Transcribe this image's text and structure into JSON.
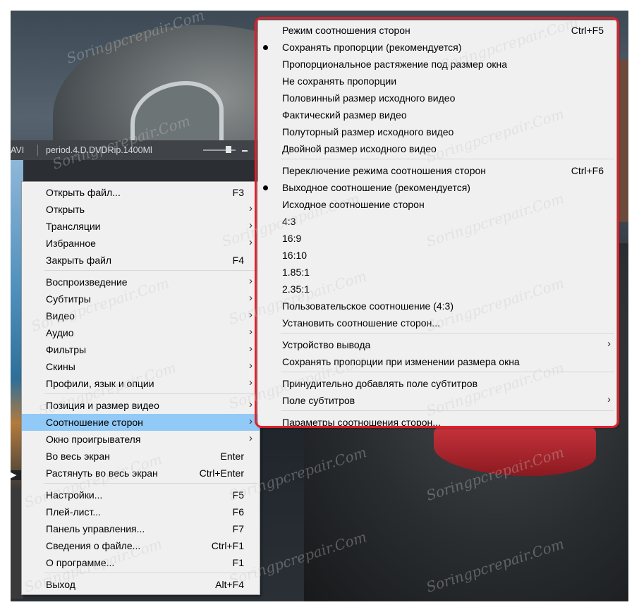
{
  "player": {
    "format": "AVI",
    "file_title": "period.4.D.DVDRip.1400Ml"
  },
  "watermark": "Soringpcrepair.Com",
  "context_menu": {
    "items": [
      {
        "label": "Открыть файл...",
        "shortcut": "F3"
      },
      {
        "label": "Открыть",
        "arrow": "›"
      },
      {
        "label": "Трансляции",
        "arrow": "›"
      },
      {
        "label": "Избранное",
        "arrow": "›"
      },
      {
        "label": "Закрыть файл",
        "shortcut": "F4"
      },
      {
        "label": "Воспроизведение",
        "arrow": "›"
      },
      {
        "label": "Субтитры",
        "arrow": "›"
      },
      {
        "label": "Видео",
        "arrow": "›"
      },
      {
        "label": "Аудио",
        "arrow": "›"
      },
      {
        "label": "Фильтры",
        "arrow": "›"
      },
      {
        "label": "Скины",
        "arrow": "›"
      },
      {
        "label": "Профили, язык и опции",
        "arrow": "›"
      },
      {
        "label": "Позиция и размер видео",
        "arrow": "›"
      },
      {
        "label": "Соотношение сторон",
        "arrow": "›",
        "highlighted": true
      },
      {
        "label": "Окно проигрывателя",
        "arrow": "›"
      },
      {
        "label": "Во весь экран",
        "shortcut": "Enter"
      },
      {
        "label": "Растянуть во весь экран",
        "shortcut": "Ctrl+Enter"
      },
      {
        "label": "Настройки...",
        "shortcut": "F5"
      },
      {
        "label": "Плей-лист...",
        "shortcut": "F6"
      },
      {
        "label": "Панель управления...",
        "shortcut": "F7"
      },
      {
        "label": "Сведения о файле...",
        "shortcut": "Ctrl+F1"
      },
      {
        "label": "О программе...",
        "shortcut": "F1"
      },
      {
        "label": "Выход",
        "shortcut": "Alt+F4"
      }
    ]
  },
  "submenu": {
    "items": [
      {
        "label": "Режим соотношения сторон",
        "shortcut": "Ctrl+F5"
      },
      {
        "label": "Сохранять пропорции (рекомендуется)",
        "checked": true
      },
      {
        "label": "Пропорциональное растяжение под размер окна"
      },
      {
        "label": "Не сохранять пропорции"
      },
      {
        "label": "Половинный размер исходного видео"
      },
      {
        "label": "Фактический размер видео"
      },
      {
        "label": "Полуторный размер исходного видео"
      },
      {
        "label": "Двойной размер исходного видео"
      },
      {
        "label": "Переключение режима соотношения сторон",
        "shortcut": "Ctrl+F6"
      },
      {
        "label": "Выходное соотношение (рекомендуется)",
        "checked": true
      },
      {
        "label": "Исходное соотношение сторон"
      },
      {
        "label": "4:3"
      },
      {
        "label": "16:9"
      },
      {
        "label": "16:10"
      },
      {
        "label": "1.85:1"
      },
      {
        "label": "2.35:1"
      },
      {
        "label": "Пользовательское соотношение (4:3)"
      },
      {
        "label": "Установить соотношение сторон..."
      },
      {
        "label": "Устройство вывода",
        "arrow": "›"
      },
      {
        "label": "Сохранять пропорции при изменении размера окна"
      },
      {
        "label": "Принудительно добавлять поле субтитров"
      },
      {
        "label": "Поле субтитров",
        "arrow": "›"
      },
      {
        "label": "Параметры соотношения сторон..."
      }
    ]
  },
  "colors": {
    "highlight": "#91c9f7",
    "annotation_frame": "#e0202a"
  }
}
